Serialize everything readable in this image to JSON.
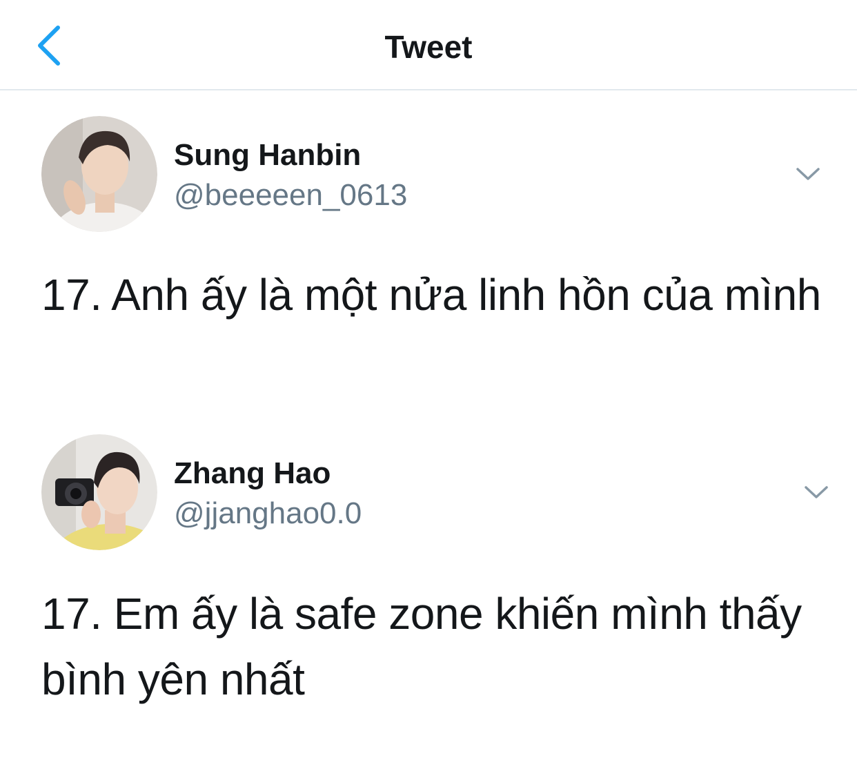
{
  "nav": {
    "title": "Tweet",
    "back_icon": "chevron-left-icon",
    "accent_color": "#1da1f2"
  },
  "tweets": [
    {
      "display_name": "Sung Hanbin",
      "handle": "@beeeeen_0613",
      "text": "17. Anh ấy là một nửa linh hồn của mình",
      "menu_icon": "chevron-down-icon"
    },
    {
      "display_name": "Zhang Hao",
      "handle": "@jjanghao0.0",
      "text": "17. Em ấy là safe zone khiến mình thấy bình yên nhất",
      "menu_icon": "chevron-down-icon"
    }
  ],
  "colors": {
    "text": "#14171a",
    "secondary": "#657786",
    "divider": "#e1e8ed"
  }
}
